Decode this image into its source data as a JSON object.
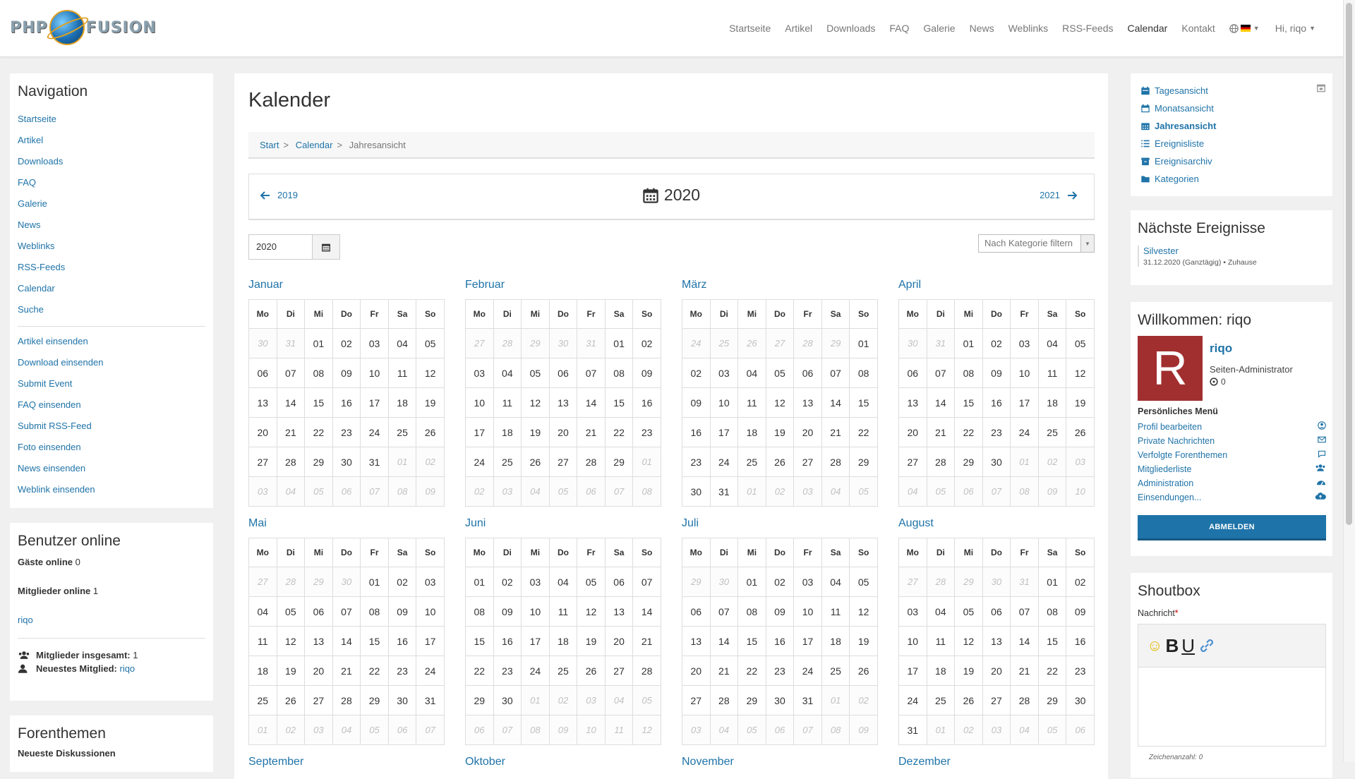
{
  "navbar": {
    "brand": "PHP-FUSION",
    "items": [
      "Startseite",
      "Artikel",
      "Downloads",
      "FAQ",
      "Galerie",
      "News",
      "Weblinks",
      "RSS-Feeds",
      "Calendar",
      "Kontakt"
    ],
    "user": "Hi, riqo"
  },
  "nav_panel": {
    "title": "Navigation",
    "items": [
      "Startseite",
      "Artikel",
      "Downloads",
      "FAQ",
      "Galerie",
      "News",
      "Weblinks",
      "RSS-Feeds",
      "Calendar",
      "Suche"
    ],
    "submit_items": [
      "Artikel einsenden",
      "Download einsenden",
      "Submit Event",
      "FAQ einsenden",
      "Submit RSS-Feed",
      "Foto einsenden",
      "News einsenden",
      "Weblink einsenden"
    ]
  },
  "online_panel": {
    "title": "Benutzer online",
    "guests_label": "Gäste online",
    "guests_count": "0",
    "members_label": "Mitglieder online",
    "members_count": "1",
    "member_name": "riqo",
    "total_label": "Mitglieder insgesamt:",
    "total_count": "1",
    "newest_label": "Neuestes Mitglied:",
    "newest_name": "riqo"
  },
  "forum_panel": {
    "title": "Forenthemen",
    "subtitle": "Neueste Diskussionen"
  },
  "main": {
    "title": "Kalender",
    "breadcrumb": [
      "Start",
      "Calendar",
      "Jahresansicht"
    ],
    "prev_year": "2019",
    "current_year": "2020",
    "next_year": "2021",
    "year_input": "2020",
    "category_filter": "Nach Kategorie filtern",
    "weekdays": [
      "Mo",
      "Di",
      "Mi",
      "Do",
      "Fr",
      "Sa",
      "So"
    ],
    "months": [
      {
        "name": "Januar",
        "start": 30,
        "prev_len": 31,
        "len": 31
      },
      {
        "name": "Februar",
        "start": 27,
        "prev_len": 31,
        "len": 29
      },
      {
        "name": "März",
        "start": 24,
        "prev_len": 29,
        "len": 31
      },
      {
        "name": "April",
        "start": 30,
        "prev_len": 31,
        "len": 30
      },
      {
        "name": "Mai",
        "start": 27,
        "prev_len": 30,
        "len": 31
      },
      {
        "name": "Juni",
        "start": 1,
        "prev_len": 31,
        "len": 30
      },
      {
        "name": "Juli",
        "start": 29,
        "prev_len": 30,
        "len": 31
      },
      {
        "name": "August",
        "start": 27,
        "prev_len": 31,
        "len": 31
      },
      {
        "name": "September"
      },
      {
        "name": "Oktober"
      },
      {
        "name": "November"
      },
      {
        "name": "Dezember"
      }
    ]
  },
  "views_panel": {
    "items": [
      "Tagesansicht",
      "Monatsansicht",
      "Jahresansicht",
      "Ereignisliste",
      "Ereignisarchiv",
      "Kategorien"
    ],
    "active": "Jahresansicht"
  },
  "events_panel": {
    "title": "Nächste Ereignisse",
    "event_title": "Silvester",
    "event_meta": "31.12.2020 (Ganztägig) • Zuhause"
  },
  "welcome_panel": {
    "title": "Willkommen: riqo",
    "avatar_letter": "R",
    "username": "riqo",
    "role": "Seiten-Administrator",
    "points": "0",
    "menu_title": "Persönliches Menü",
    "menu": [
      "Profil bearbeiten",
      "Private Nachrichten",
      "Verfolgte Forenthemen",
      "Mitgliederliste",
      "Administration",
      "Einsendungen..."
    ],
    "logout": "ABMELDEN"
  },
  "shoutbox": {
    "title": "Shoutbox",
    "message_label": "Nachricht",
    "required_mark": "*",
    "char_count": "Zeichenanzahl: 0"
  },
  "colors": {
    "link": "#1f73a8",
    "button": "#1e73a8",
    "avatar": "#a12f2f"
  }
}
